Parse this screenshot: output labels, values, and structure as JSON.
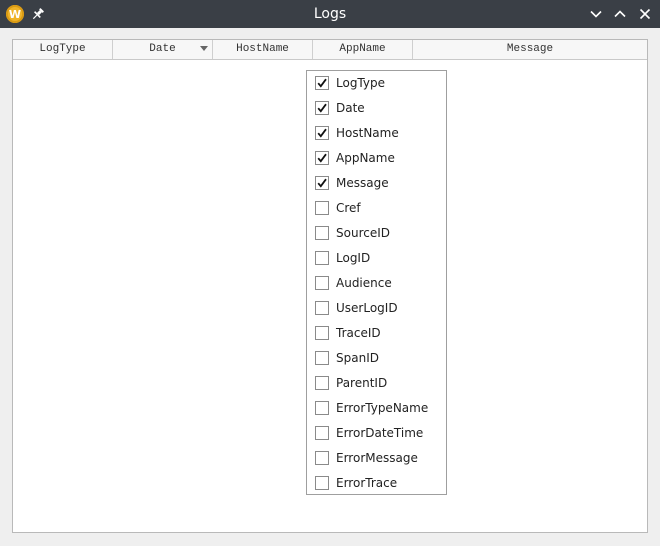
{
  "window": {
    "title": "Logs",
    "app_icon_letter": "W"
  },
  "table": {
    "columns": [
      {
        "label": "LogType"
      },
      {
        "label": "Date",
        "sorted": "descending"
      },
      {
        "label": "HostName"
      },
      {
        "label": "AppName"
      },
      {
        "label": "Message"
      }
    ]
  },
  "column_chooser": {
    "options": [
      {
        "label": "LogType",
        "checked": true
      },
      {
        "label": "Date",
        "checked": true
      },
      {
        "label": "HostName",
        "checked": true
      },
      {
        "label": "AppName",
        "checked": true
      },
      {
        "label": "Message",
        "checked": true
      },
      {
        "label": "Cref",
        "checked": false
      },
      {
        "label": "SourceID",
        "checked": false
      },
      {
        "label": "LogID",
        "checked": false
      },
      {
        "label": "Audience",
        "checked": false
      },
      {
        "label": "UserLogID",
        "checked": false
      },
      {
        "label": "TraceID",
        "checked": false
      },
      {
        "label": "SpanID",
        "checked": false
      },
      {
        "label": "ParentID",
        "checked": false
      },
      {
        "label": "ErrorTypeName",
        "checked": false
      },
      {
        "label": "ErrorDateTime",
        "checked": false
      },
      {
        "label": "ErrorMessage",
        "checked": false
      },
      {
        "label": "ErrorTrace",
        "checked": false
      }
    ]
  },
  "icons": {
    "app": "app-logo-icon",
    "pin": "pin-icon",
    "minimize": "chevron-down-icon",
    "maximize": "chevron-up-icon",
    "close": "close-icon"
  },
  "colors": {
    "titlebar": "#3a3f46",
    "app_icon": "#f0b429",
    "background": "#efefef"
  }
}
